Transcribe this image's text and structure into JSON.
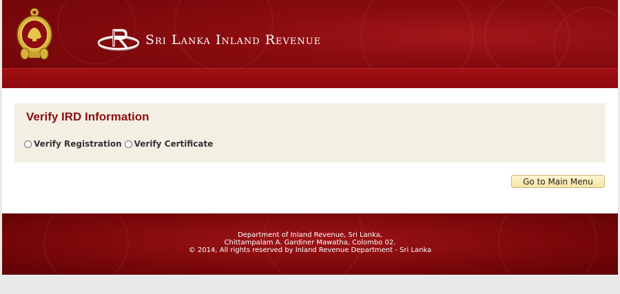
{
  "header": {
    "title": "Sri Lanka Inland Revenue"
  },
  "main": {
    "heading": "Verify IRD Information",
    "options": [
      {
        "label": "Verify Registration",
        "checked": false
      },
      {
        "label": "Verify Certificate",
        "checked": false
      }
    ],
    "main_menu_button": "Go to Main Menu"
  },
  "footer": {
    "line1": "Department of Inland Revenue, Sri Lanka,",
    "line2": "Chittampalam A. Gardiner Mawatha, Colombo 02.",
    "line3": "© 2014, All rights reserved by Inland Revenue Department - Sri Lanka"
  },
  "colors": {
    "header_red": "#8a0c0f",
    "heading_red": "#8c0d0f",
    "panel_bg": "#f4efe3",
    "button_bg": "#f6e4a3"
  },
  "icons": {
    "emblem": "sri-lanka-emblem-icon",
    "brand": "ird-logo-icon"
  }
}
